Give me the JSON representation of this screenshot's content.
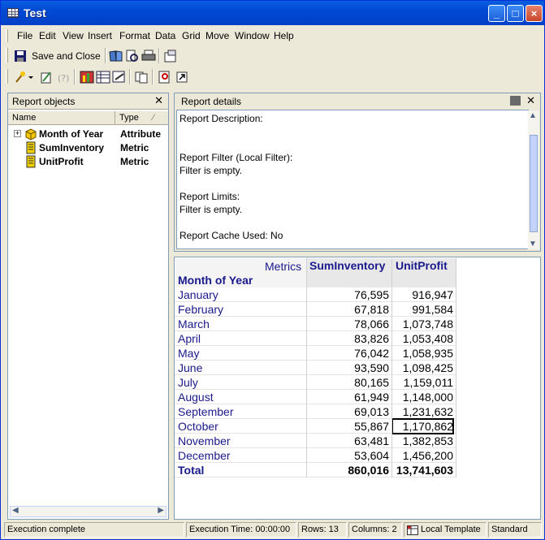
{
  "window": {
    "title": "Test"
  },
  "menu": [
    "File",
    "Edit",
    "View",
    "Insert",
    "Format",
    "Data",
    "Grid",
    "Move",
    "Window",
    "Help"
  ],
  "toolbar": {
    "save_label": "Save and Close"
  },
  "report_objects": {
    "title": "Report objects",
    "columns": [
      "Name",
      "Type"
    ],
    "rows": [
      {
        "name": "Month of Year",
        "type": "Attribute",
        "icon": "attribute-icon"
      },
      {
        "name": "SumInventory",
        "type": "Metric",
        "icon": "metric-icon"
      },
      {
        "name": "UnitProfit",
        "type": "Metric",
        "icon": "metric-icon"
      }
    ]
  },
  "report_details": {
    "title": "Report details",
    "lines": [
      "Report Description:",
      "Report Filter (Local Filter):",
      "Filter is empty.",
      "Report Limits:",
      "Filter is empty.",
      "Report Cache Used: No"
    ]
  },
  "grid": {
    "metrics_label": "Metrics",
    "row_header": "Month of Year",
    "col1": "SumInventory",
    "col2": "UnitProfit",
    "rows": [
      {
        "m": "January",
        "a": "76,595",
        "b": "916,947"
      },
      {
        "m": "February",
        "a": "67,818",
        "b": "991,584"
      },
      {
        "m": "March",
        "a": "78,066",
        "b": "1,073,748"
      },
      {
        "m": "April",
        "a": "83,826",
        "b": "1,053,408"
      },
      {
        "m": "May",
        "a": "76,042",
        "b": "1,058,935"
      },
      {
        "m": "June",
        "a": "93,590",
        "b": "1,098,425"
      },
      {
        "m": "July",
        "a": "80,165",
        "b": "1,159,011"
      },
      {
        "m": "August",
        "a": "61,949",
        "b": "1,148,000"
      },
      {
        "m": "September",
        "a": "69,013",
        "b": "1,231,632"
      },
      {
        "m": "October",
        "a": "55,867",
        "b": "1,170,862"
      },
      {
        "m": "November",
        "a": "63,481",
        "b": "1,382,853"
      },
      {
        "m": "December",
        "a": "53,604",
        "b": "1,456,200"
      }
    ],
    "total": {
      "m": "Total",
      "a": "860,016",
      "b": "13,741,603"
    }
  },
  "status": {
    "message": "Execution complete",
    "time": "Execution Time: 00:00:00",
    "rows": "Rows: 13",
    "columns": "Columns: 2",
    "template": "Local Template",
    "mode": "Standard"
  },
  "colors": {
    "title_bar": "#0a5fe0",
    "grid_header": "#1a1a8c",
    "selected_cell_border": "#000000"
  }
}
